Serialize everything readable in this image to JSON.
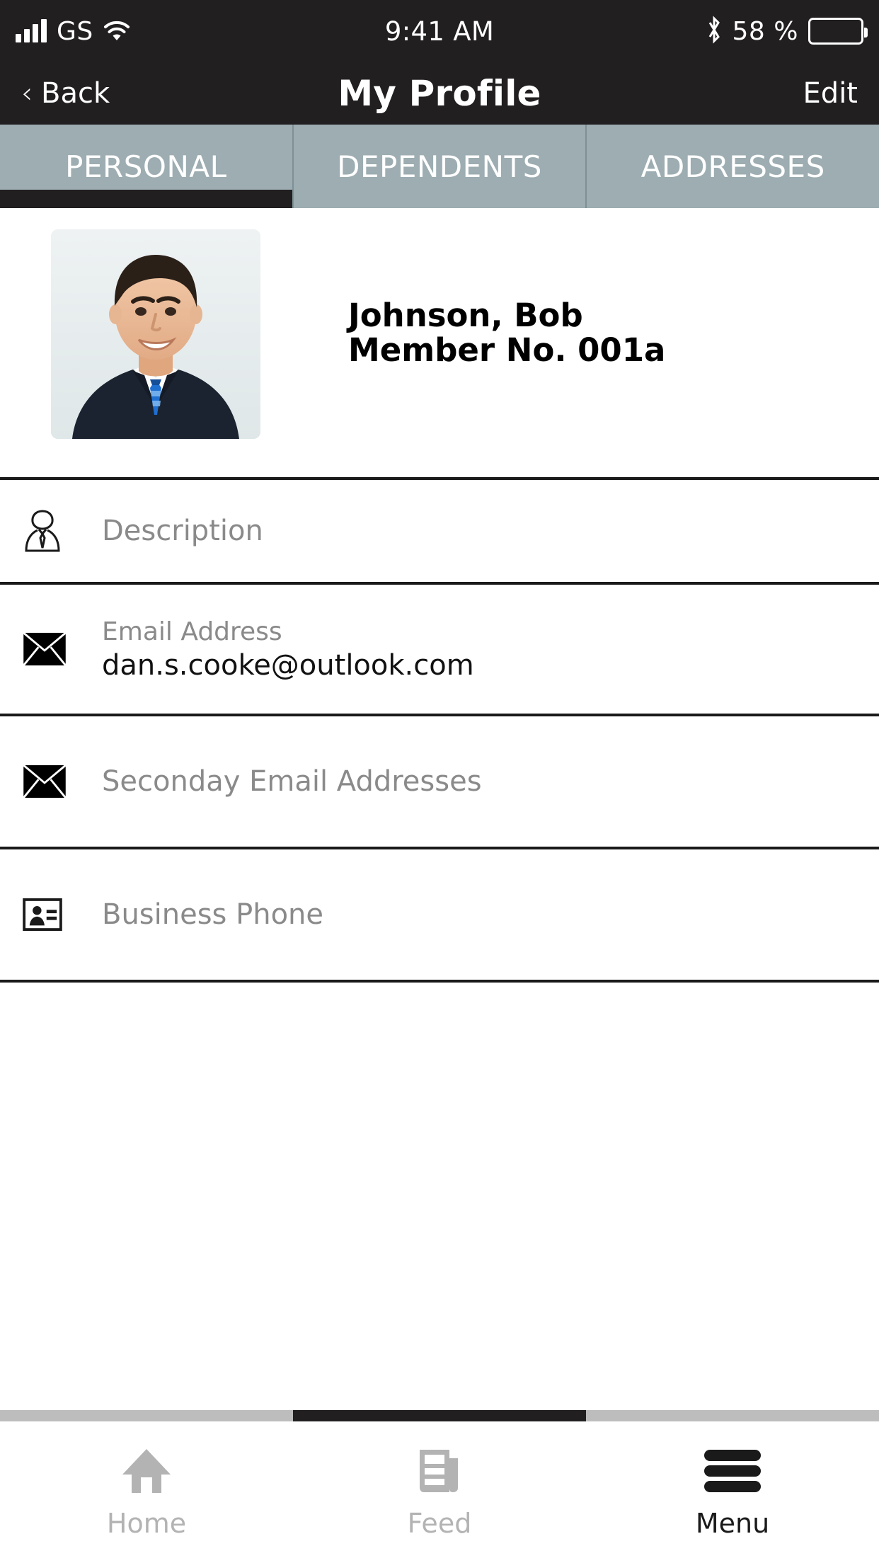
{
  "status_bar": {
    "carrier": "GS",
    "time": "9:41 AM",
    "battery_percent": "58 %",
    "signal_icon": "signal-bars-icon",
    "wifi_icon": "wifi-icon",
    "bluetooth_icon": "bluetooth-icon",
    "battery_icon": "battery-icon",
    "battery_level": 58
  },
  "nav": {
    "back_label": "Back",
    "back_chevron": "‹",
    "title": "My Profile",
    "edit_label": "Edit"
  },
  "tabs": {
    "items": [
      {
        "label": "PERSONAL",
        "active": true
      },
      {
        "label": "DEPENDENTS",
        "active": false
      },
      {
        "label": "ADDRESSES",
        "active": false
      }
    ],
    "background_color": "#9dadb2",
    "active_indicator_color": "#221f20"
  },
  "profile": {
    "photo_alt": "profile-photo",
    "name": "Johnson, Bob",
    "member_no": "Member No. 001a"
  },
  "fields": [
    {
      "icon": "person-tie-icon",
      "label": "",
      "placeholder": "Description",
      "value": ""
    },
    {
      "icon": "envelope-icon",
      "label": "Email Address",
      "placeholder": "",
      "value": "dan.s.cooke@outlook.com"
    },
    {
      "icon": "envelope-icon",
      "label": "",
      "placeholder": "Seconday Email Addresses",
      "value": ""
    },
    {
      "icon": "contact-card-icon",
      "label": "",
      "placeholder": "Business Phone",
      "value": ""
    }
  ],
  "bottom_bar": {
    "items": [
      {
        "label": "Home",
        "icon": "home-icon",
        "active": false
      },
      {
        "label": "Feed",
        "icon": "feed-icon",
        "active": false
      },
      {
        "label": "Menu",
        "icon": "hamburger-menu-icon",
        "active": true
      }
    ],
    "inactive_color": "#b3b3b3",
    "active_color": "#1a1a1a"
  }
}
